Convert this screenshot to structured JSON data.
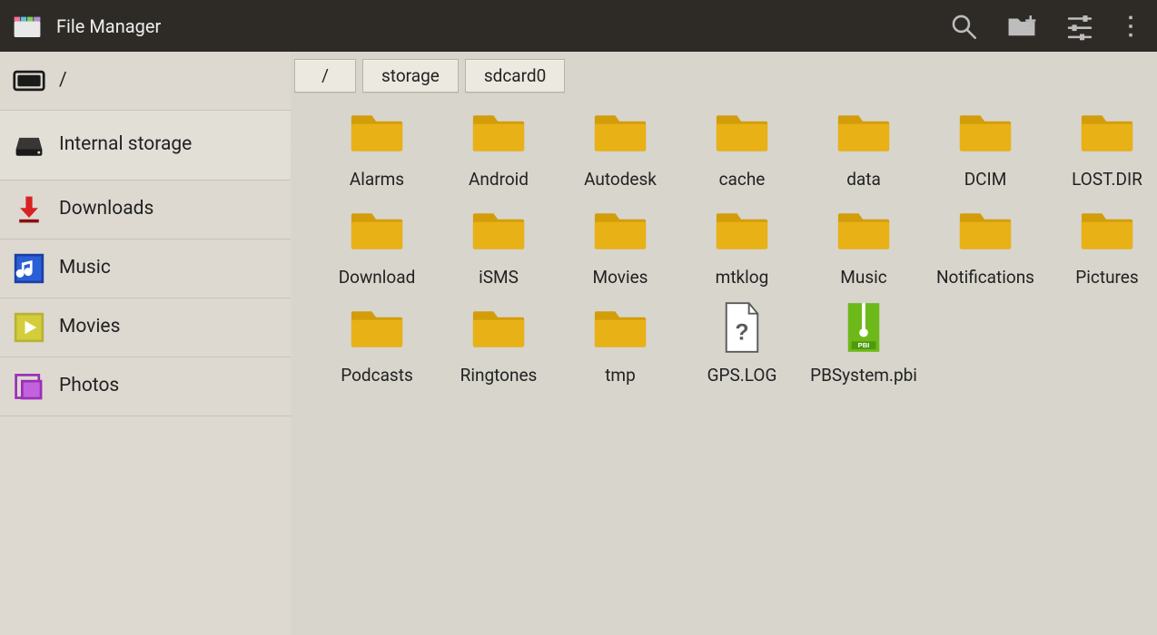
{
  "app_title": "File Manager",
  "sidebar": {
    "items": [
      {
        "id": "root",
        "label": "/",
        "icon": "sd-outline-icon",
        "selected": false,
        "tall": false
      },
      {
        "id": "internal",
        "label": "Internal storage",
        "icon": "drive-icon",
        "selected": true,
        "tall": true
      },
      {
        "id": "downloads",
        "label": "Downloads",
        "icon": "download-icon",
        "selected": false,
        "tall": false
      },
      {
        "id": "music",
        "label": "Music",
        "icon": "music-icon",
        "selected": false,
        "tall": false
      },
      {
        "id": "movies",
        "label": "Movies",
        "icon": "movie-icon",
        "selected": false,
        "tall": false
      },
      {
        "id": "photos",
        "label": "Photos",
        "icon": "photos-icon",
        "selected": false,
        "tall": false
      }
    ]
  },
  "breadcrumbs": [
    "/",
    "storage",
    "sdcard0"
  ],
  "files": [
    {
      "name": "Alarms",
      "type": "folder"
    },
    {
      "name": "Android",
      "type": "folder"
    },
    {
      "name": "Autodesk",
      "type": "folder"
    },
    {
      "name": "cache",
      "type": "folder"
    },
    {
      "name": "data",
      "type": "folder"
    },
    {
      "name": "DCIM",
      "type": "folder"
    },
    {
      "name": "LOST.DIR",
      "type": "folder"
    },
    {
      "name": "Download",
      "type": "folder"
    },
    {
      "name": "iSMS",
      "type": "folder"
    },
    {
      "name": "Movies",
      "type": "folder"
    },
    {
      "name": "mtklog",
      "type": "folder"
    },
    {
      "name": "Music",
      "type": "folder"
    },
    {
      "name": "Notifications",
      "type": "folder"
    },
    {
      "name": "Pictures",
      "type": "folder"
    },
    {
      "name": "Podcasts",
      "type": "folder"
    },
    {
      "name": "Ringtones",
      "type": "folder"
    },
    {
      "name": "tmp",
      "type": "folder"
    },
    {
      "name": "GPS.LOG",
      "type": "unknown"
    },
    {
      "name": "PBSystem.pbi",
      "type": "archive"
    }
  ],
  "colors": {
    "folder": "#e8b116",
    "folder_shadow": "#d39d0a",
    "archive": "#6db91a"
  }
}
